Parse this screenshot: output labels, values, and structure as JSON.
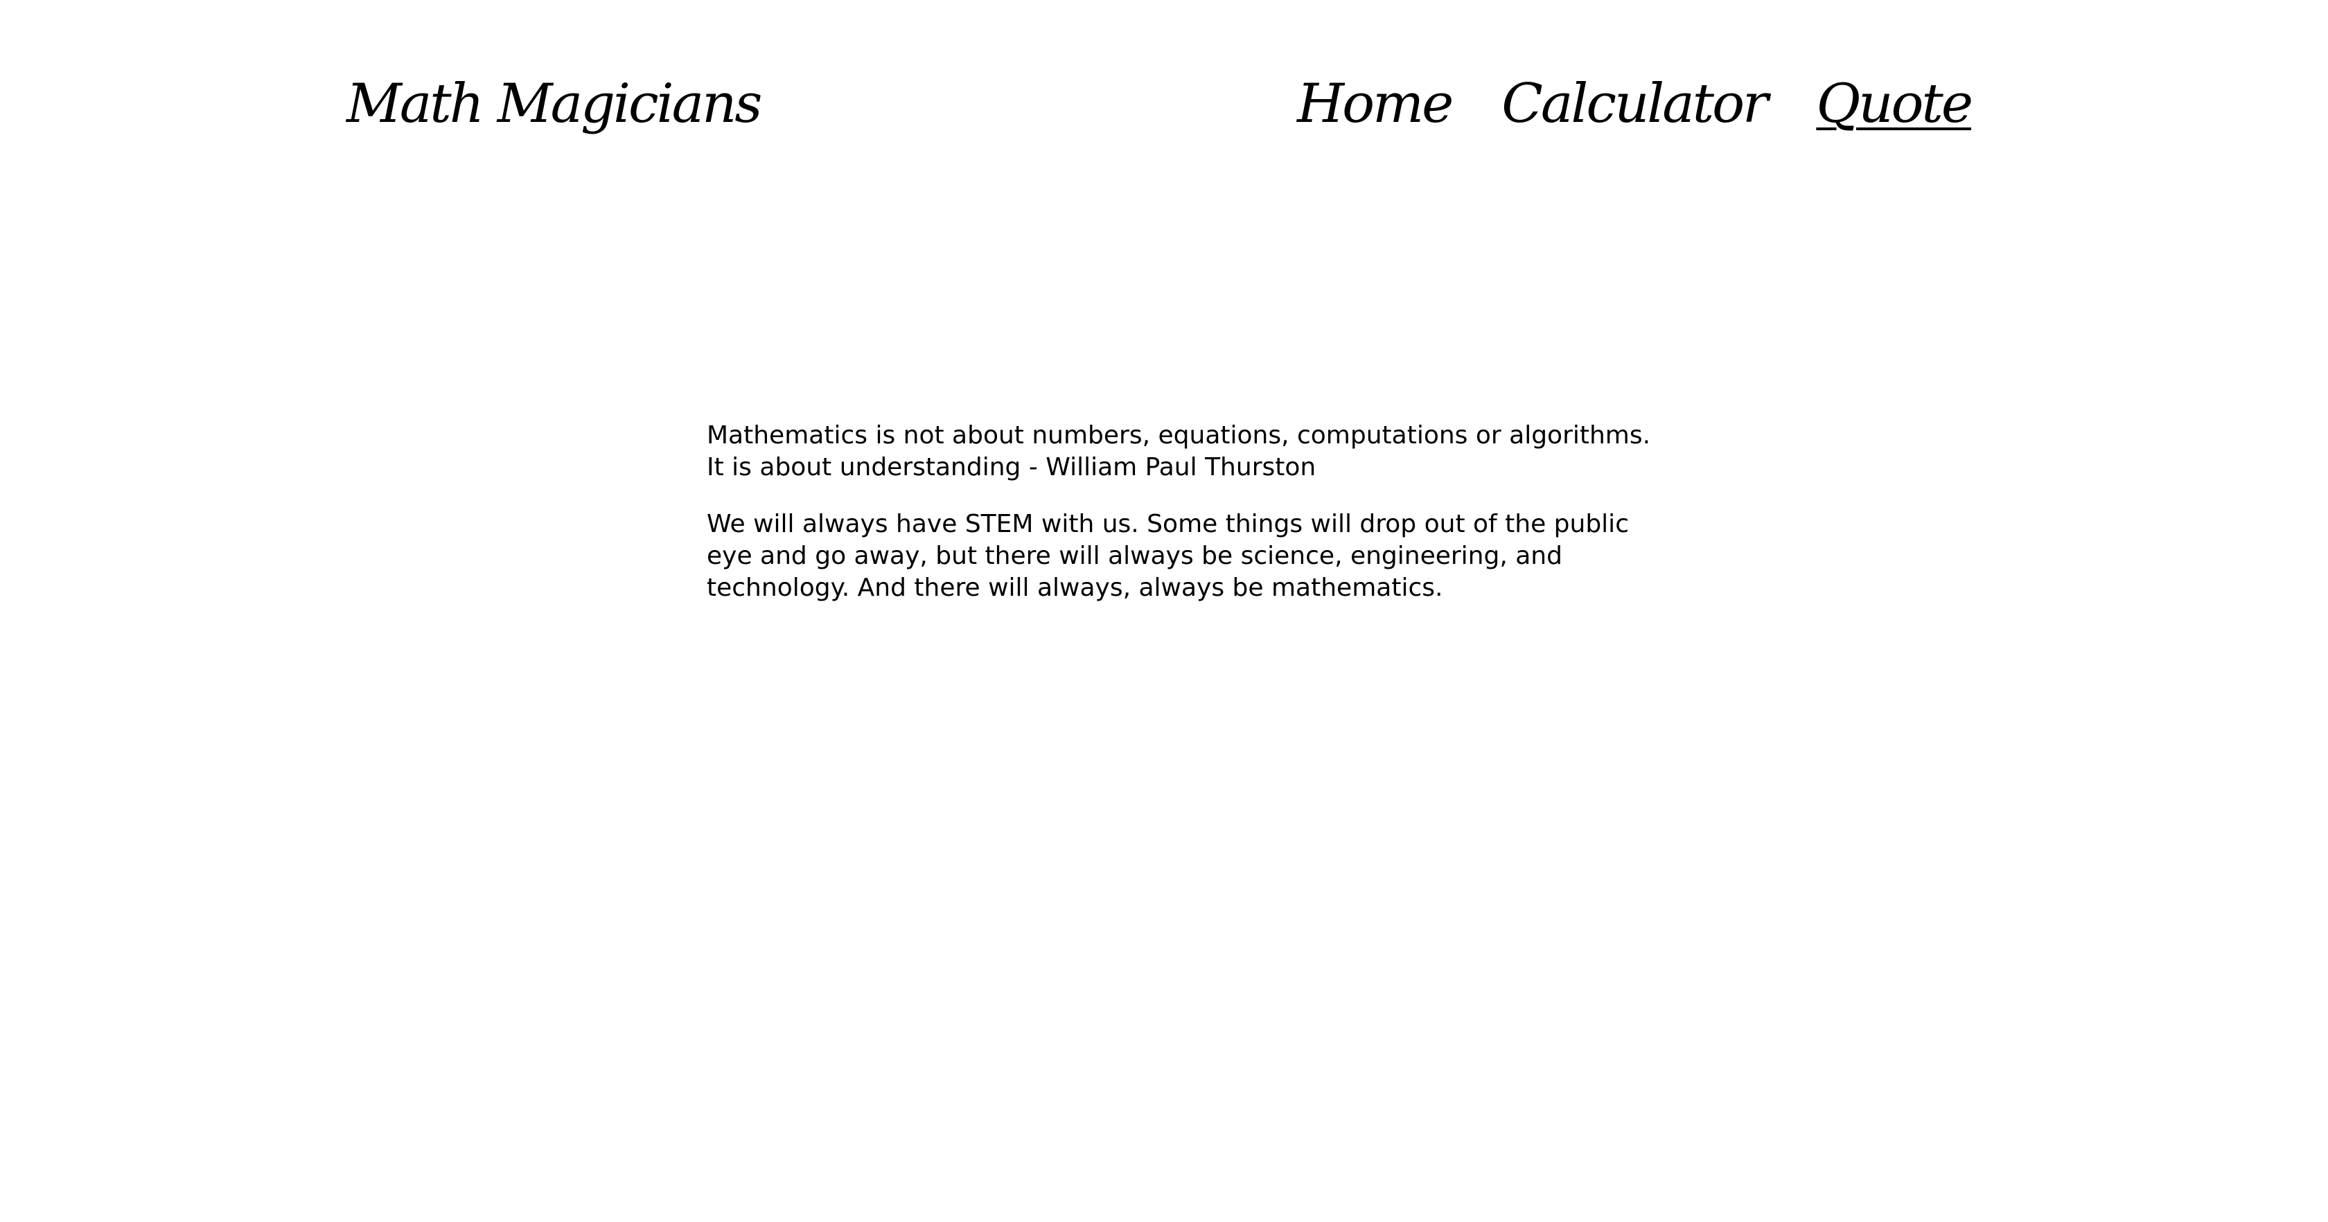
{
  "header": {
    "brand": "Math Magicians",
    "nav": [
      {
        "label": "Home",
        "active": false
      },
      {
        "label": "Calculator",
        "active": false
      },
      {
        "label": "Quote",
        "active": true
      }
    ]
  },
  "main": {
    "quotes": [
      "Mathematics is not about numbers, equations, computations or algorithms. It is about understanding - William Paul Thurston",
      "We will always have STEM with us. Some things will drop out of the public eye and go away, but there will always be science, engineering, and technology. And there will always, always be mathematics."
    ]
  }
}
